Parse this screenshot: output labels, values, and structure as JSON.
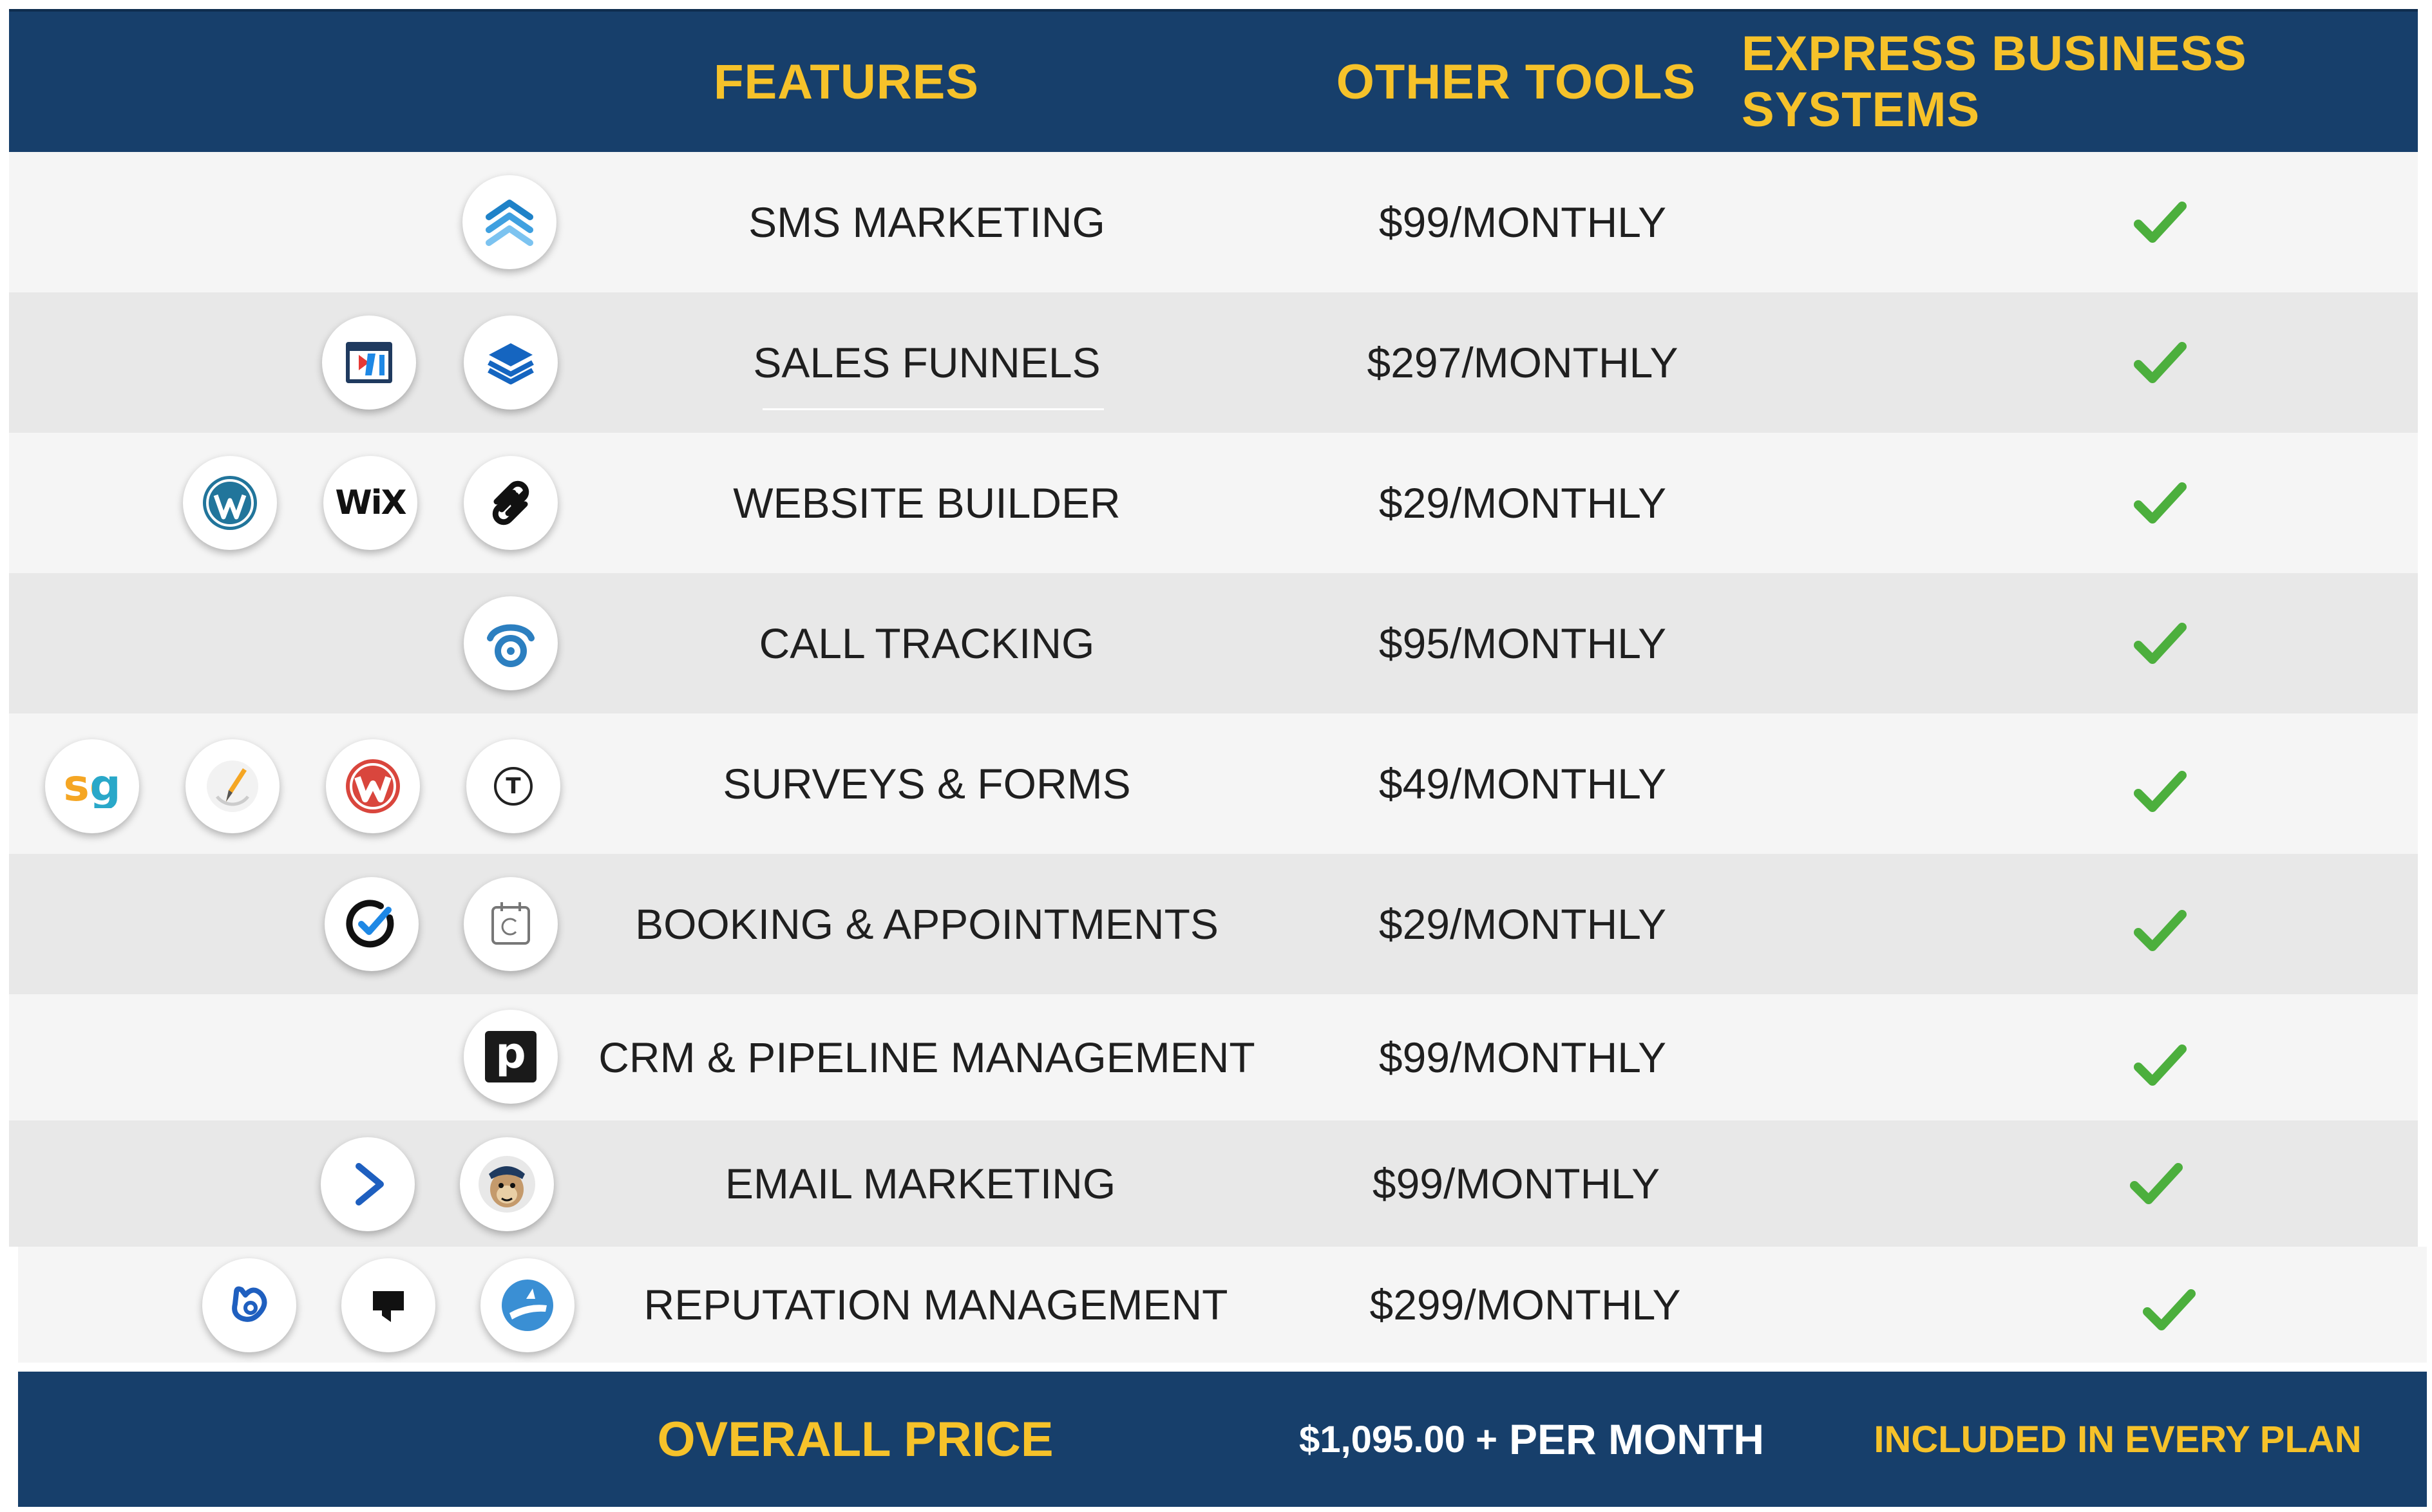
{
  "header": {
    "features": "FEATURES",
    "other_tools": "OTHER TOOLS",
    "express": "EXPRESS BUSINESS SYSTEMS"
  },
  "rows": [
    {
      "feature": "SMS MARKETING",
      "price": "$99/MONTHLY",
      "icons": [
        "chevrons-up-icon"
      ],
      "included": true
    },
    {
      "feature": "SALES FUNNELS",
      "price": "$297/MONTHLY",
      "icons": [
        "clickfunnels-icon",
        "layers-icon"
      ],
      "included": true
    },
    {
      "feature": "WEBSITE BUILDER",
      "price": "$29/MONTHLY",
      "icons": [
        "wordpress-icon",
        "wix-icon",
        "squarespace-icon"
      ],
      "included": true,
      "wix_text": "WiX"
    },
    {
      "feature": "CALL TRACKING",
      "price": "$95/MONTHLY",
      "icons": [
        "callrail-icon"
      ],
      "included": true
    },
    {
      "feature": "SURVEYS & FORMS",
      "price": "$49/MONTHLY",
      "icons": [
        "surveygizmo-icon",
        "pencil-icon",
        "wufoo-icon",
        "typeform-icon"
      ],
      "included": true,
      "sg_text": "sg",
      "t_text": "T"
    },
    {
      "feature": "BOOKING & APPOINTMENTS",
      "price": "$29/MONTHLY",
      "icons": [
        "acuity-check-icon",
        "calendly-icon"
      ],
      "included": true
    },
    {
      "feature": "CRM & PIPELINE MANAGEMENT",
      "price": "$99/MONTHLY",
      "icons": [
        "pipedrive-icon"
      ],
      "included": true,
      "p_text": "p"
    },
    {
      "feature": "EMAIL MARKETING",
      "price": "$99/MONTHLY",
      "icons": [
        "activecampaign-icon",
        "mailchimp-icon"
      ],
      "included": true
    },
    {
      "feature": "REPUTATION MANAGEMENT",
      "price": "$299/MONTHLY",
      "icons": [
        "birdeye-icon",
        "podium-icon",
        "grade-us-icon"
      ],
      "included": true
    }
  ],
  "footer": {
    "label": "OVERALL PRICE",
    "price_amount": "$1,095.00 +",
    "price_suffix": "PER MONTH",
    "included": "INCLUDED IN EVERY PLAN"
  },
  "colors": {
    "navy": "#173f6b",
    "gold": "#f6c22a",
    "check_green": "#4caf3d"
  }
}
